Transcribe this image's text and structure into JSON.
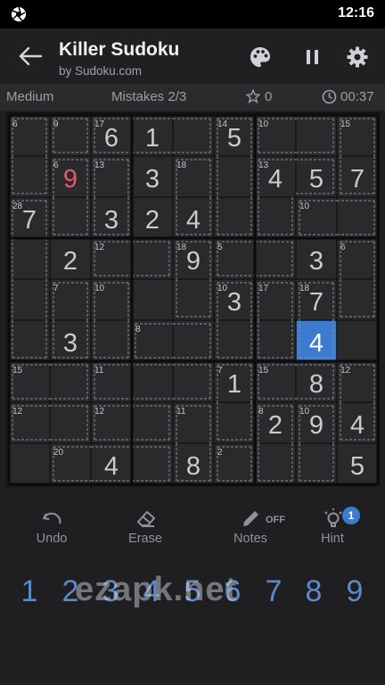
{
  "status_bar": {
    "time": "12:16",
    "left_icon": "aperture-icon"
  },
  "app_bar": {
    "title": "Killer Sudoku",
    "subtitle": "by Sudoku.com",
    "actions": [
      "palette-icon",
      "pause-icon",
      "settings-gear-icon"
    ]
  },
  "info_bar": {
    "difficulty": "Medium",
    "mistakes": "Mistakes 2/3",
    "score": "0",
    "timer": "00:37"
  },
  "colors": {
    "background": "#1f1f21",
    "selected_cell": "#3d7bd0",
    "error_digit": "#e55a6e",
    "given_digit": "#c9cbcd",
    "number_pad": "#5b8ac8"
  },
  "board": {
    "selected": [
      5,
      7
    ],
    "error_cells": [
      [
        1,
        1
      ]
    ],
    "values": [
      [
        0,
        0,
        6,
        1,
        0,
        5,
        0,
        0,
        0
      ],
      [
        0,
        9,
        0,
        3,
        0,
        0,
        4,
        5,
        7
      ],
      [
        7,
        0,
        3,
        2,
        4,
        0,
        0,
        0,
        0
      ],
      [
        0,
        2,
        0,
        0,
        9,
        0,
        0,
        3,
        0
      ],
      [
        0,
        0,
        0,
        0,
        0,
        3,
        0,
        7,
        0
      ],
      [
        0,
        3,
        0,
        0,
        0,
        0,
        0,
        4,
        0
      ],
      [
        0,
        0,
        0,
        0,
        0,
        1,
        0,
        8,
        0
      ],
      [
        0,
        0,
        0,
        0,
        0,
        0,
        2,
        9,
        4
      ],
      [
        0,
        0,
        4,
        0,
        8,
        0,
        0,
        0,
        5
      ]
    ],
    "cages": [
      {
        "sum": 6,
        "cells": [
          [
            0,
            0
          ],
          [
            1,
            0
          ]
        ]
      },
      {
        "sum": 9,
        "cells": [
          [
            0,
            1
          ]
        ]
      },
      {
        "sum": 17,
        "cells": [
          [
            0,
            2
          ],
          [
            0,
            3
          ],
          [
            0,
            4
          ]
        ]
      },
      {
        "sum": 14,
        "cells": [
          [
            0,
            5
          ],
          [
            1,
            5
          ],
          [
            2,
            5
          ]
        ]
      },
      {
        "sum": 10,
        "cells": [
          [
            0,
            6
          ],
          [
            0,
            7
          ]
        ]
      },
      {
        "sum": 15,
        "cells": [
          [
            0,
            8
          ],
          [
            1,
            8
          ]
        ]
      },
      {
        "sum": 6,
        "cells": [
          [
            1,
            1
          ],
          [
            2,
            1
          ]
        ]
      },
      {
        "sum": 13,
        "cells": [
          [
            1,
            2
          ],
          [
            2,
            2
          ]
        ]
      },
      {
        "sum": 18,
        "cells": [
          [
            1,
            4
          ],
          [
            2,
            4
          ]
        ]
      },
      {
        "sum": 13,
        "cells": [
          [
            1,
            6
          ],
          [
            1,
            7
          ],
          [
            2,
            6
          ]
        ]
      },
      {
        "sum": 28,
        "cells": [
          [
            2,
            0
          ],
          [
            3,
            0
          ],
          [
            4,
            0
          ],
          [
            5,
            0
          ]
        ]
      },
      {
        "sum": 10,
        "cells": [
          [
            2,
            7
          ],
          [
            2,
            8
          ]
        ]
      },
      {
        "sum": 12,
        "cells": [
          [
            3,
            2
          ],
          [
            3,
            3
          ]
        ]
      },
      {
        "sum": 18,
        "cells": [
          [
            3,
            4
          ],
          [
            4,
            4
          ]
        ]
      },
      {
        "sum": 5,
        "cells": [
          [
            3,
            5
          ],
          [
            3,
            6
          ]
        ]
      },
      {
        "sum": 6,
        "cells": [
          [
            3,
            8
          ],
          [
            4,
            8
          ]
        ]
      },
      {
        "sum": 7,
        "cells": [
          [
            4,
            1
          ],
          [
            5,
            1
          ]
        ]
      },
      {
        "sum": 10,
        "cells": [
          [
            4,
            2
          ],
          [
            5,
            2
          ]
        ]
      },
      {
        "sum": 10,
        "cells": [
          [
            4,
            5
          ],
          [
            5,
            5
          ]
        ]
      },
      {
        "sum": 17,
        "cells": [
          [
            4,
            6
          ],
          [
            5,
            6
          ]
        ]
      },
      {
        "sum": 18,
        "cells": [
          [
            4,
            7
          ],
          [
            5,
            7
          ]
        ]
      },
      {
        "sum": 8,
        "cells": [
          [
            5,
            3
          ],
          [
            5,
            4
          ]
        ]
      },
      {
        "sum": 15,
        "cells": [
          [
            6,
            0
          ],
          [
            6,
            1
          ]
        ]
      },
      {
        "sum": 11,
        "cells": [
          [
            6,
            2
          ],
          [
            6,
            3
          ],
          [
            6,
            4
          ]
        ]
      },
      {
        "sum": 7,
        "cells": [
          [
            6,
            5
          ],
          [
            7,
            5
          ]
        ]
      },
      {
        "sum": 15,
        "cells": [
          [
            6,
            6
          ],
          [
            6,
            7
          ]
        ]
      },
      {
        "sum": 12,
        "cells": [
          [
            6,
            8
          ],
          [
            7,
            8
          ]
        ]
      },
      {
        "sum": 12,
        "cells": [
          [
            7,
            0
          ],
          [
            7,
            1
          ]
        ]
      },
      {
        "sum": 12,
        "cells": [
          [
            7,
            2
          ],
          [
            7,
            3
          ]
        ]
      },
      {
        "sum": 11,
        "cells": [
          [
            7,
            4
          ],
          [
            8,
            4
          ]
        ]
      },
      {
        "sum": 8,
        "cells": [
          [
            7,
            6
          ],
          [
            8,
            6
          ]
        ]
      },
      {
        "sum": 10,
        "cells": [
          [
            7,
            7
          ],
          [
            8,
            7
          ]
        ]
      },
      {
        "sum": 20,
        "cells": [
          [
            8,
            1
          ],
          [
            8,
            2
          ],
          [
            8,
            3
          ]
        ]
      },
      {
        "sum": 2,
        "cells": [
          [
            8,
            5
          ]
        ]
      }
    ]
  },
  "controls": [
    {
      "label": "Undo",
      "icon": "undo-icon"
    },
    {
      "label": "Erase",
      "icon": "eraser-icon"
    },
    {
      "label": "Notes",
      "icon": "pencil-icon",
      "state": "OFF"
    },
    {
      "label": "Hint",
      "icon": "lightbulb-icon",
      "badge": "1"
    }
  ],
  "number_pad": [
    "1",
    "2",
    "3",
    "4",
    "5",
    "6",
    "7",
    "8",
    "9"
  ],
  "watermark": "ezapk.net"
}
